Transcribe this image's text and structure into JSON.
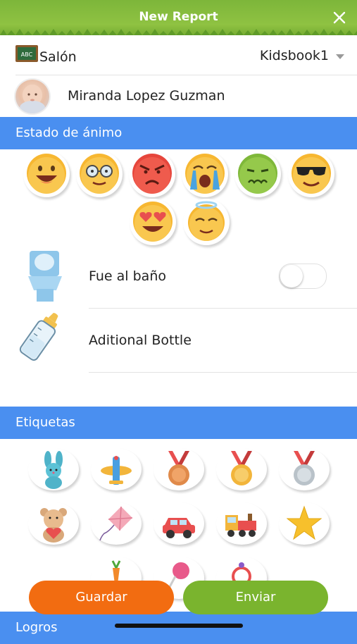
{
  "header": {
    "title": "New Report",
    "close_icon": "close-icon"
  },
  "salon": {
    "label": "Salón",
    "selected": "Kidsbook1",
    "icon": "chalkboard-icon"
  },
  "student": {
    "name": "Miranda Lopez Guzman"
  },
  "mood_section": {
    "title": "Estado de ánimo",
    "moods": [
      "happy-face-icon",
      "glasses-face-icon",
      "angry-face-icon",
      "crying-face-icon",
      "sick-face-icon",
      "sunglasses-face-icon",
      "heart-eyes-face-icon",
      "angel-face-icon"
    ]
  },
  "activities": [
    {
      "label": "Fue al baño",
      "icon": "toilet-icon",
      "toggle": false
    },
    {
      "label": "Aditional Bottle",
      "icon": "baby-bottle-icon"
    }
  ],
  "tags_section": {
    "title": "Etiquetas",
    "tags": [
      "bunny-icon",
      "airplane-icon",
      "bronze-medal-icon",
      "gold-medal-icon",
      "silver-medal-icon",
      "teddy-bear-icon",
      "kite-icon",
      "toy-car-icon",
      "toy-train-icon",
      "star-icon",
      "carrot-icon",
      "lollipop-icon",
      "rattle-icon"
    ]
  },
  "achievements_section": {
    "title": "Logros"
  },
  "buttons": {
    "save": "Guardar",
    "send": "Enviar"
  },
  "colors": {
    "header_green": "#8fc242",
    "section_blue": "#4a8ff0",
    "save_orange": "#f26c11",
    "send_green": "#7ab42e"
  }
}
